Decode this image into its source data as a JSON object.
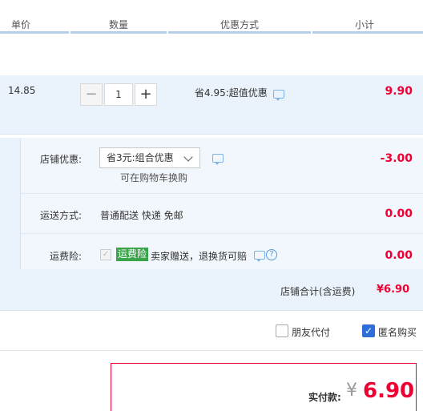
{
  "header": {
    "col_price": "单价",
    "col_qty": "数量",
    "col_promo": "优惠方式",
    "col_subtotal": "小计"
  },
  "item": {
    "price": "14.85",
    "quantity": "1",
    "promo": "省4.95:超值优惠",
    "subtotal": "9.90",
    "minus_label": "−",
    "plus_label": "+"
  },
  "shop": {
    "discount_label": "店铺优惠:",
    "discount_select": "省3元:组合优惠",
    "discount_hint": "可在购物车换购",
    "discount_amount": "-3.00",
    "shipping_label": "运送方式:",
    "shipping_value": "普通配送 快递 免邮",
    "shipping_amount": "0.00",
    "insurance_label": "运费险:",
    "insurance_badge": "运费险",
    "insurance_text": "卖家赠送，退换货可赔",
    "insurance_amount": "0.00",
    "total_label": "店铺合计(含运费)",
    "total_amount": "¥6.90"
  },
  "options": {
    "friend_pay": "朋友代付",
    "anonymous": "匿名购买"
  },
  "payment": {
    "label": "实付款:",
    "currency": "¥",
    "amount": "6.90"
  },
  "colors": {
    "accent_red": "#ee0033",
    "row_bg": "#eaf2fb",
    "badge_green": "#3aa44b",
    "check_blue": "#2f6ed8"
  },
  "icons": [
    "message-icon",
    "question-icon",
    "chevron-down-icon",
    "check-icon"
  ]
}
